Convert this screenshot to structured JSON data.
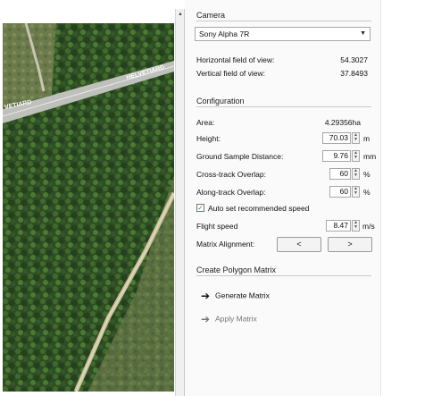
{
  "map": {
    "road_label_left": "VETIARD",
    "road_label_right": "HELVETIARD"
  },
  "camera": {
    "section_title": "Camera",
    "selected_camera": "Sony Alpha 7R",
    "hfov_label": "Horizontal field of view:",
    "hfov_value": "54.3027",
    "vfov_label": "Vertical field of view:",
    "vfov_value": "37.8493"
  },
  "configuration": {
    "section_title": "Configuration",
    "area_label": "Area:",
    "area_value": "4.29356ha",
    "height_label": "Height:",
    "height_value": "70.03",
    "height_unit": "m",
    "gsd_label": "Ground Sample Distance:",
    "gsd_value": "9.76",
    "gsd_unit": "mm",
    "cross_label": "Cross-track Overlap:",
    "cross_value": "60",
    "cross_unit": "%",
    "along_label": "Along-track Overlap:",
    "along_value": "60",
    "along_unit": "%",
    "auto_label": "Auto set recommended speed",
    "auto_checked": true,
    "speed_label": "Flight speed",
    "speed_value": "8.47",
    "speed_unit": "m/s",
    "matrix_label": "Matrix Alignment:",
    "prev_label": "<",
    "next_label": ">"
  },
  "create": {
    "section_title": "Create Polygon Matrix",
    "generate_label": "Generate Matrix",
    "apply_label": "Apply Matrix"
  },
  "colors": {
    "generate_arrow": "#111111",
    "apply_arrow": "#777777",
    "apply_text": "#777777"
  }
}
